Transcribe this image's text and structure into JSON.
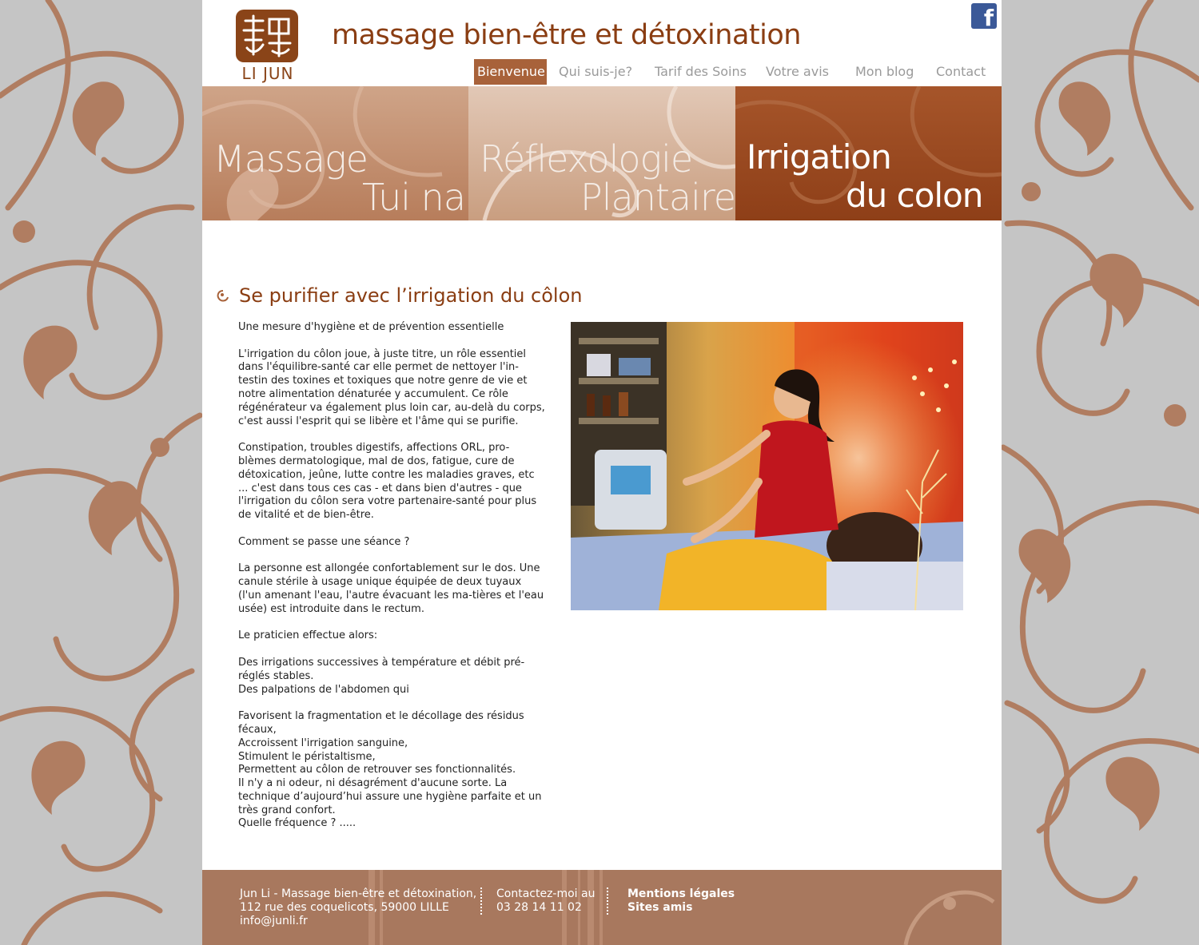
{
  "header": {
    "logo_text": "LI JUN",
    "title": "massage bien-être et détoxination",
    "facebook_label": "f"
  },
  "nav": {
    "items": [
      {
        "label": "Bienvenue",
        "active": true
      },
      {
        "label": "Qui suis-je?",
        "active": false
      },
      {
        "label": "Tarif des Soins",
        "active": false
      },
      {
        "label": "Votre avis",
        "active": false
      },
      {
        "label": "Mon blog",
        "active": false
      },
      {
        "label": "Contact",
        "active": false
      }
    ]
  },
  "banner": {
    "panels": [
      {
        "line1": "Massage",
        "line2": "Tui na"
      },
      {
        "line1": "Réflexologie",
        "line2": "Plantaire"
      },
      {
        "line1": "Irrigation",
        "line2": "du colon"
      }
    ]
  },
  "content": {
    "title": "Se purifier avec l’irrigation du côlon",
    "paragraphs": [
      "Une mesure d'hygiène et de prévention essentielle",
      "L'irrigation du côlon joue, à juste titre, un rôle essentiel dans l'équilibre-santé car elle permet de nettoyer l'in-testin des toxines et toxiques que notre genre de vie et notre alimentation dénaturée y accumulent. Ce rôle régénérateur va également plus loin car, au-delà du corps, c'est aussi l'esprit qui se libère et l'âme qui se purifie.",
      "Constipation, troubles digestifs, affections ORL, pro-blèmes dermatologique, mal de dos, fatigue, cure de détoxication, jeûne, lutte contre les maladies graves, etc ... c'est dans tous ces cas - et dans bien d'autres - que l'irrigation du côlon sera votre partenaire-santé pour plus de vitalité et de bien-être.",
      "Comment se passe une séance ?",
      "La personne est allongée confortablement sur le dos. Une canule stérile à usage unique équipée de deux tuyaux (l'un amenant l'eau, l'autre évacuant les ma-tières et l'eau usée) est introduite dans le rectum.",
      "Le praticien effectue alors:",
      "Des irrigations successives à température et débit pré-réglés stables.\nDes palpations de l'abdomen qui",
      "Favorisent la fragmentation et le décollage des résidus fécaux,\nAccroissent l'irrigation sanguine,\nStimulent le péristaltisme,\nPermettent au côlon de retrouver ses fonctionnalités.\nIl n'y a ni odeur, ni désagrément d'aucune sorte. La technique d’aujourd’hui assure une hygiène parfaite et un très grand confort.\nQuelle fréquence ? ....."
    ]
  },
  "footer": {
    "address_line1": "Jun Li - Massage bien-être et détoxination,",
    "address_line2": "112 rue des coquelicots, 59000 LILLE",
    "email": "info@junli.fr",
    "contact_line1": "Contactez-moi au",
    "phone": "03 28 14 11 02",
    "legal_link": "Mentions légales",
    "friends_link": "Sites amis"
  },
  "colors": {
    "brand_brown": "#8a3d12",
    "nav_active_bg": "#a8623a",
    "background_gray": "#c5c5c5",
    "swirl_brown": "#b07d61"
  }
}
